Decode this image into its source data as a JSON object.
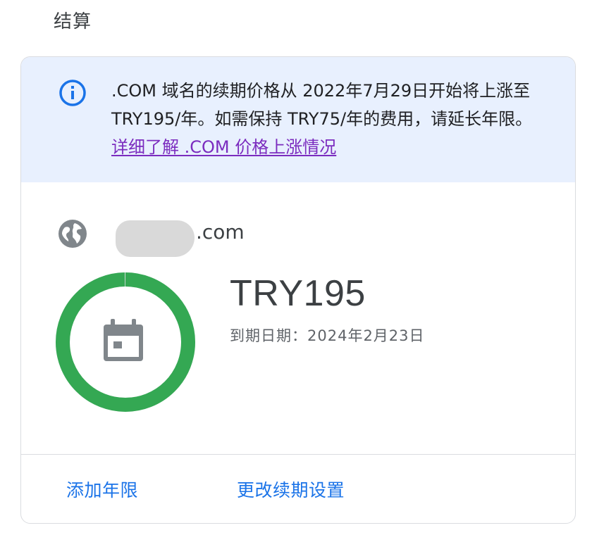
{
  "section": {
    "title": "结算"
  },
  "notice": {
    "icon": "info-icon",
    "message": ".COM 域名的续期价格从 2022年7月29日开始将上涨至 TRY195/年。如需保持 TRY75/年的费用，请延长年限。",
    "link_text": "详细了解 .COM 价格上涨情况",
    "accent_color": "#1a73e8"
  },
  "domain": {
    "icon": "globe-icon",
    "suffix": ".com"
  },
  "renewal": {
    "price": "TRY195",
    "expiry_label": "到期日期：",
    "expiry_date": "2024年2月23日",
    "ring_fill_fraction": 0.998,
    "ring_color": "#34a853",
    "icon": "calendar-icon"
  },
  "actions": {
    "add_years": "添加年限",
    "change_renewal": "更改续期设置"
  }
}
